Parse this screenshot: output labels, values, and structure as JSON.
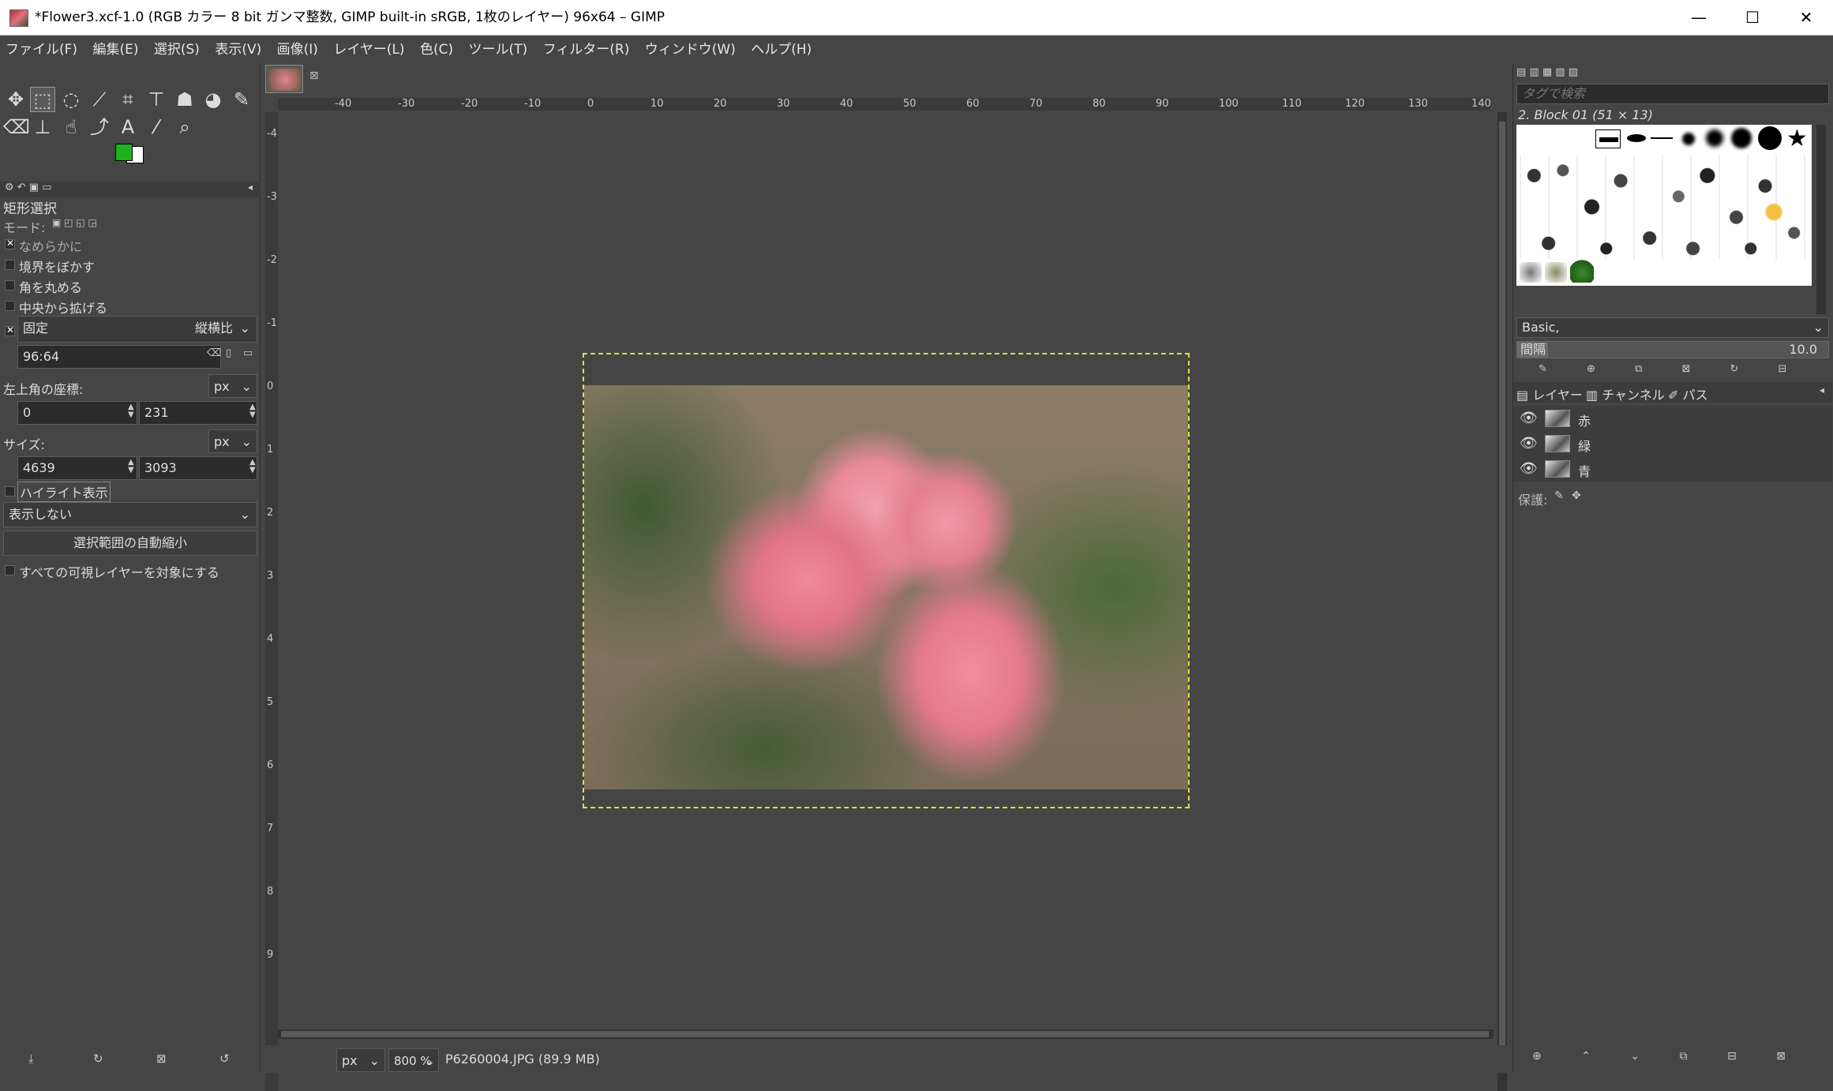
{
  "window": {
    "title": "*Flower3.xcf-1.0 (RGB カラー 8 bit ガンマ整数, GIMP built-in sRGB, 1枚のレイヤー) 96x64 – GIMP",
    "minimize": "—",
    "maximize": "☐",
    "close": "✕"
  },
  "menu": [
    "ファイル(F)",
    "編集(E)",
    "選択(S)",
    "表示(V)",
    "画像(I)",
    "レイヤー(L)",
    "色(C)",
    "ツール(T)",
    "フィルター(R)",
    "ウィンドウ(W)",
    "ヘルプ(H)"
  ],
  "tool_options": {
    "title": "矩形選択",
    "mode_label": "モード:",
    "antialias": "なめらかに",
    "feather": "境界をぼかす",
    "rounded": "角を丸める",
    "expand_center": "中央から拡げる",
    "fixed_label": "固定",
    "fixed_mode": "縦横比",
    "fixed_value": "96:64",
    "position_label": "左上角の座標:",
    "position_unit": "px",
    "pos_x": "0",
    "pos_y": "231",
    "size_label": "サイズ:",
    "size_unit": "px",
    "size_w": "4639",
    "size_h": "3093",
    "highlight": "ハイライト表示",
    "guides": "表示しない",
    "auto_shrink": "選択範囲の自動縮小",
    "all_layers": "すべての可視レイヤーを対象にする"
  },
  "colors": {
    "foreground": "#1db31d",
    "background": "#ffffff"
  },
  "ruler_h_labels": [
    "-40",
    "-30",
    "-20",
    "-10",
    "0",
    "10",
    "20",
    "30",
    "40",
    "50",
    "60",
    "70",
    "80",
    "90",
    "100",
    "110",
    "120",
    "130",
    "140"
  ],
  "ruler_v_labels": [
    "-4",
    "-3",
    "-2",
    "-1",
    "0",
    "1",
    "2",
    "3",
    "4",
    "5",
    "6",
    "7",
    "8",
    "9"
  ],
  "brushes": {
    "tag_search_placeholder": "タグで検索",
    "current": "2. Block 01 (51 × 13)",
    "preset": "Basic,",
    "spacing_label": "間隔",
    "spacing_value": "10.0"
  },
  "layers": {
    "tabs": [
      "レイヤー",
      "チャンネル",
      "パス"
    ],
    "items": [
      "赤",
      "緑",
      "青"
    ],
    "lock_label": "保護:"
  },
  "status": {
    "unit": "px",
    "zoom": "800 %",
    "info": "P6260004.JPG (89.9 MB)"
  }
}
